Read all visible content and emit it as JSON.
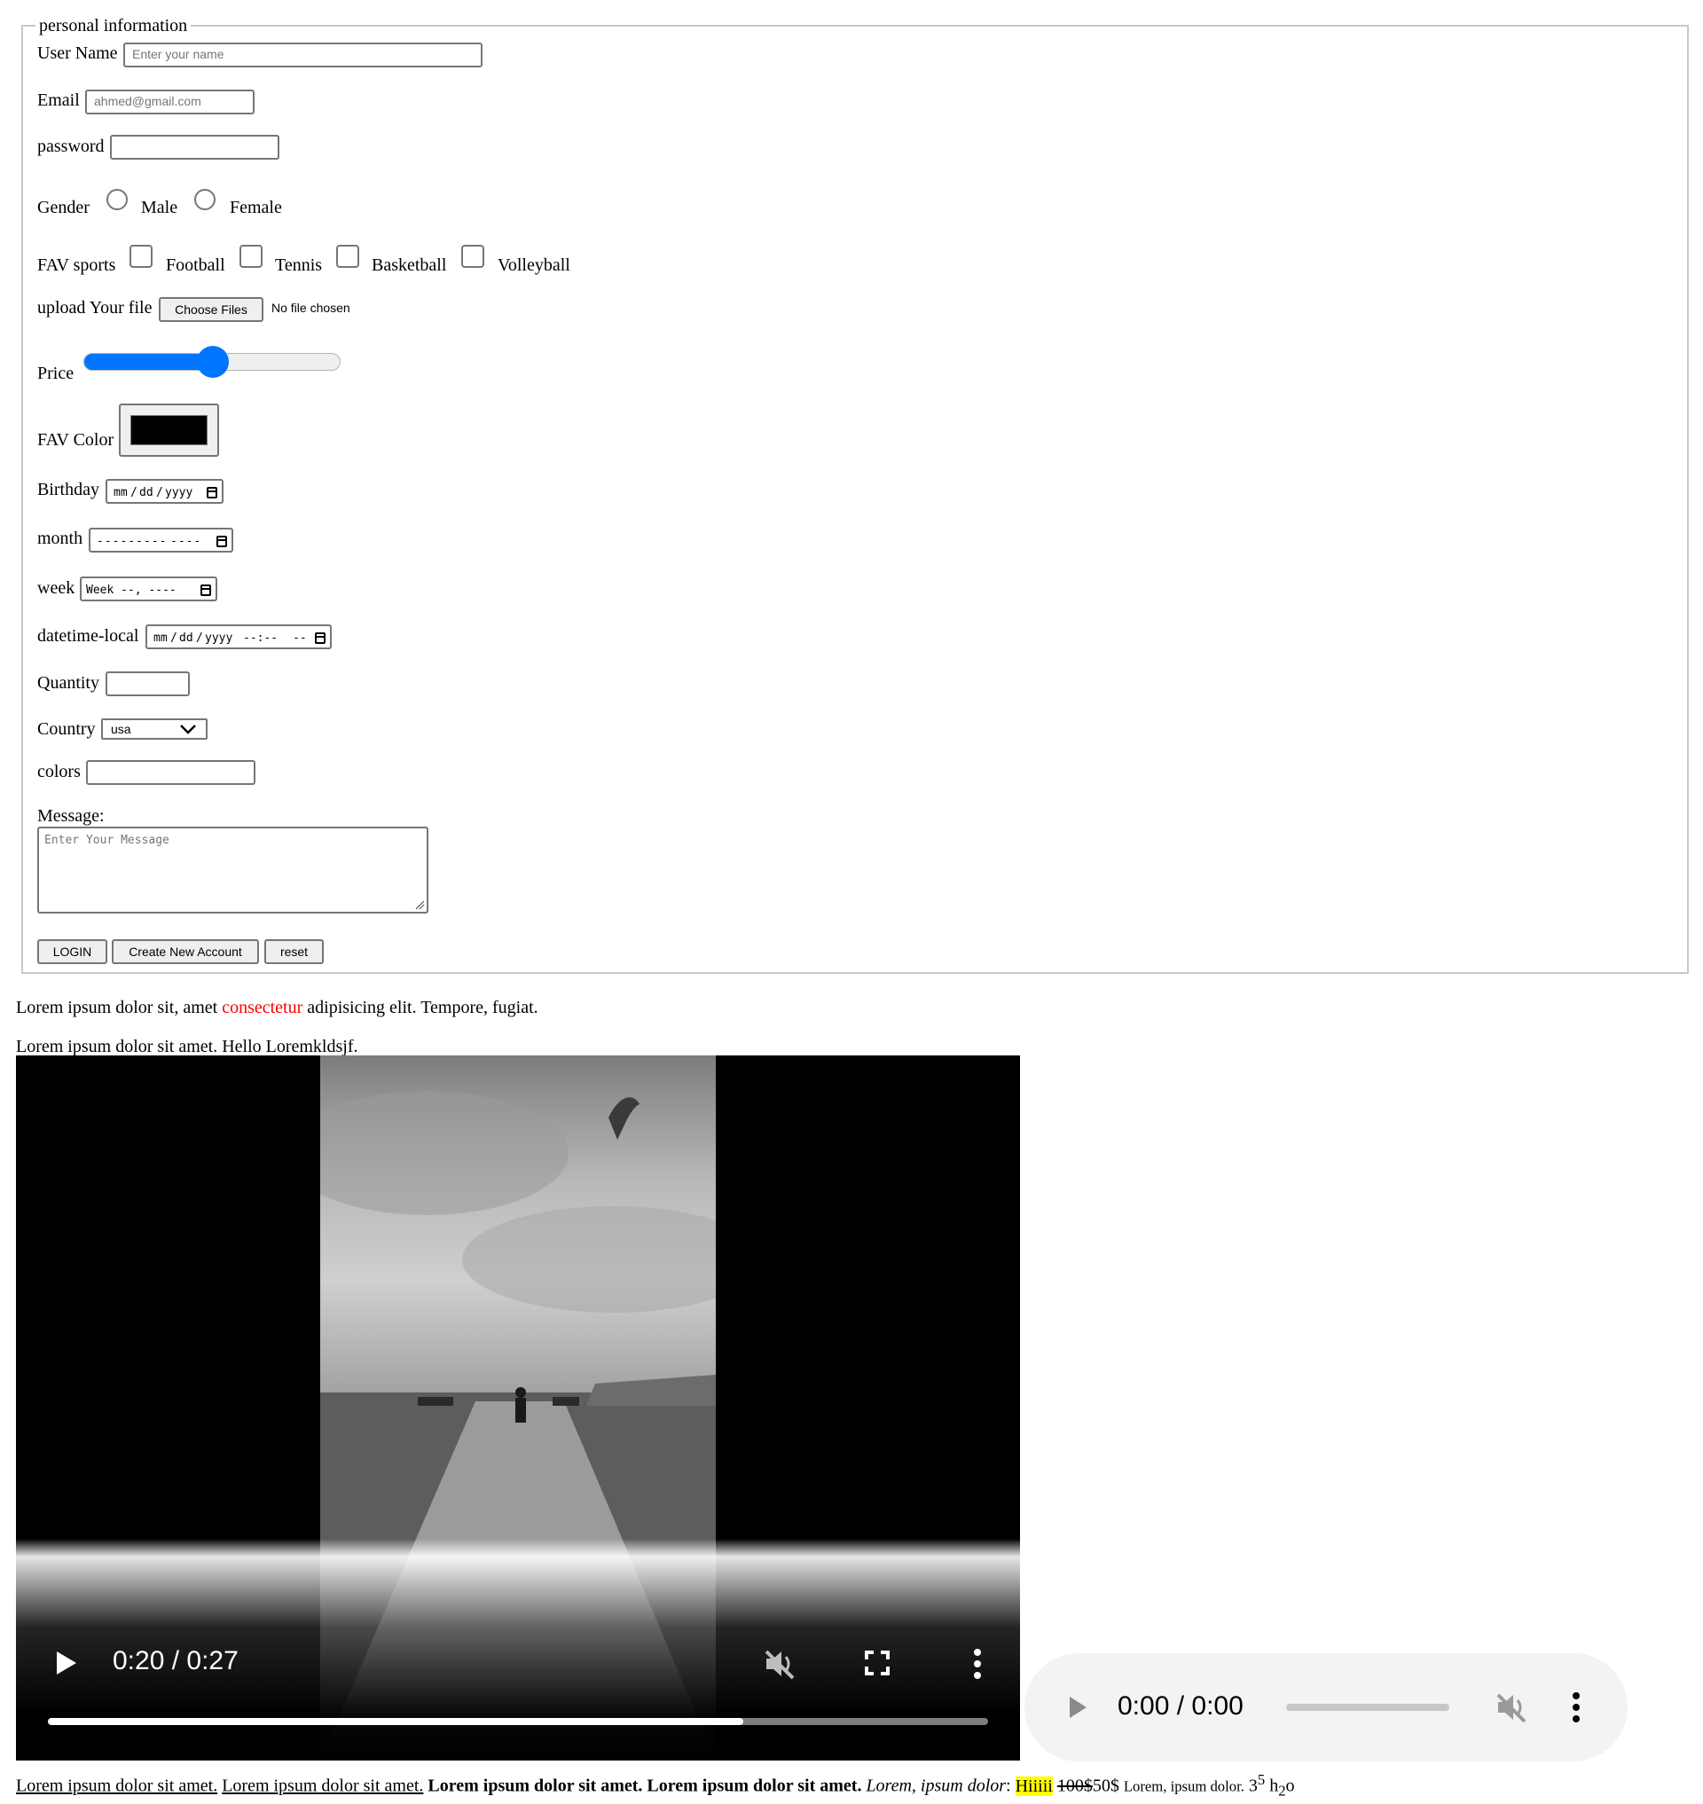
{
  "form": {
    "legend": "personal information",
    "username": {
      "label": "User Name",
      "placeholder": "Enter your name",
      "value": ""
    },
    "email": {
      "label": "Email",
      "placeholder": "ahmed@gmail.com",
      "value": ""
    },
    "password": {
      "label": "password",
      "value": ""
    },
    "gender": {
      "label": "Gender",
      "options": [
        "Male",
        "Female"
      ],
      "selected": null
    },
    "sports": {
      "label": "FAV sports",
      "options": [
        "Football",
        "Tennis",
        "Basketball",
        "Volleyball"
      ],
      "checked": []
    },
    "upload": {
      "label": "upload Your file",
      "button": "Choose Files",
      "status": "No file chosen"
    },
    "price": {
      "label": "Price",
      "value_fraction": 0.5
    },
    "color": {
      "label": "FAV Color",
      "value": "#000000"
    },
    "birthday": {
      "label": "Birthday",
      "mm": "mm",
      "dd": "dd",
      "yyyy": "yyyy",
      "sep": "/"
    },
    "month": {
      "label": "month",
      "placeholder_month": "---------",
      "placeholder_year": "----"
    },
    "week": {
      "label": "week",
      "placeholder": "Week --, ----"
    },
    "datetime": {
      "label": "datetime-local",
      "mm": "mm",
      "dd": "dd",
      "yyyy": "yyyy",
      "sep": "/",
      "time": "--:--",
      "ampm": "--"
    },
    "quantity": {
      "label": "Quantity",
      "value": ""
    },
    "country": {
      "label": "Country",
      "selected": "usa"
    },
    "colors": {
      "label": "colors",
      "value": ""
    },
    "message": {
      "label": "Message:",
      "placeholder": "Enter Your Message"
    },
    "buttons": {
      "login": "LOGIN",
      "create": "Create New Account",
      "reset": "reset"
    }
  },
  "paragraphs": {
    "p1_before": "Lorem ipsum dolor sit, amet ",
    "p1_red": "consectetur",
    "p1_after": " adipisicing elit. Tempore, fugiat.",
    "p1_red_color": "#ff0000",
    "p2": "Lorem ipsum dolor sit amet. Hello Loremkldsjf."
  },
  "video": {
    "time": "0:20 / 0:27",
    "progress_fraction": 0.74,
    "muted": true
  },
  "audio": {
    "time": "0:00 / 0:00",
    "muted": true
  },
  "bottom": {
    "u1": "Lorem ipsum dolor sit amet.",
    "u2": "Lorem ipsum dolor sit amet.",
    "b1": "Lorem ipsum dolor sit amet.",
    "b2": "Lorem ipsum dolor sit amet.",
    "i1": "Lorem, ipsum dolor",
    "colon": ":",
    "mark": "Hiiiii",
    "del": "100$",
    "ins": "50$",
    "small": "Lorem, ipsum dolor.",
    "base": "3",
    "sup": "5",
    "h": "h",
    "sub": "2",
    "o": "o"
  }
}
